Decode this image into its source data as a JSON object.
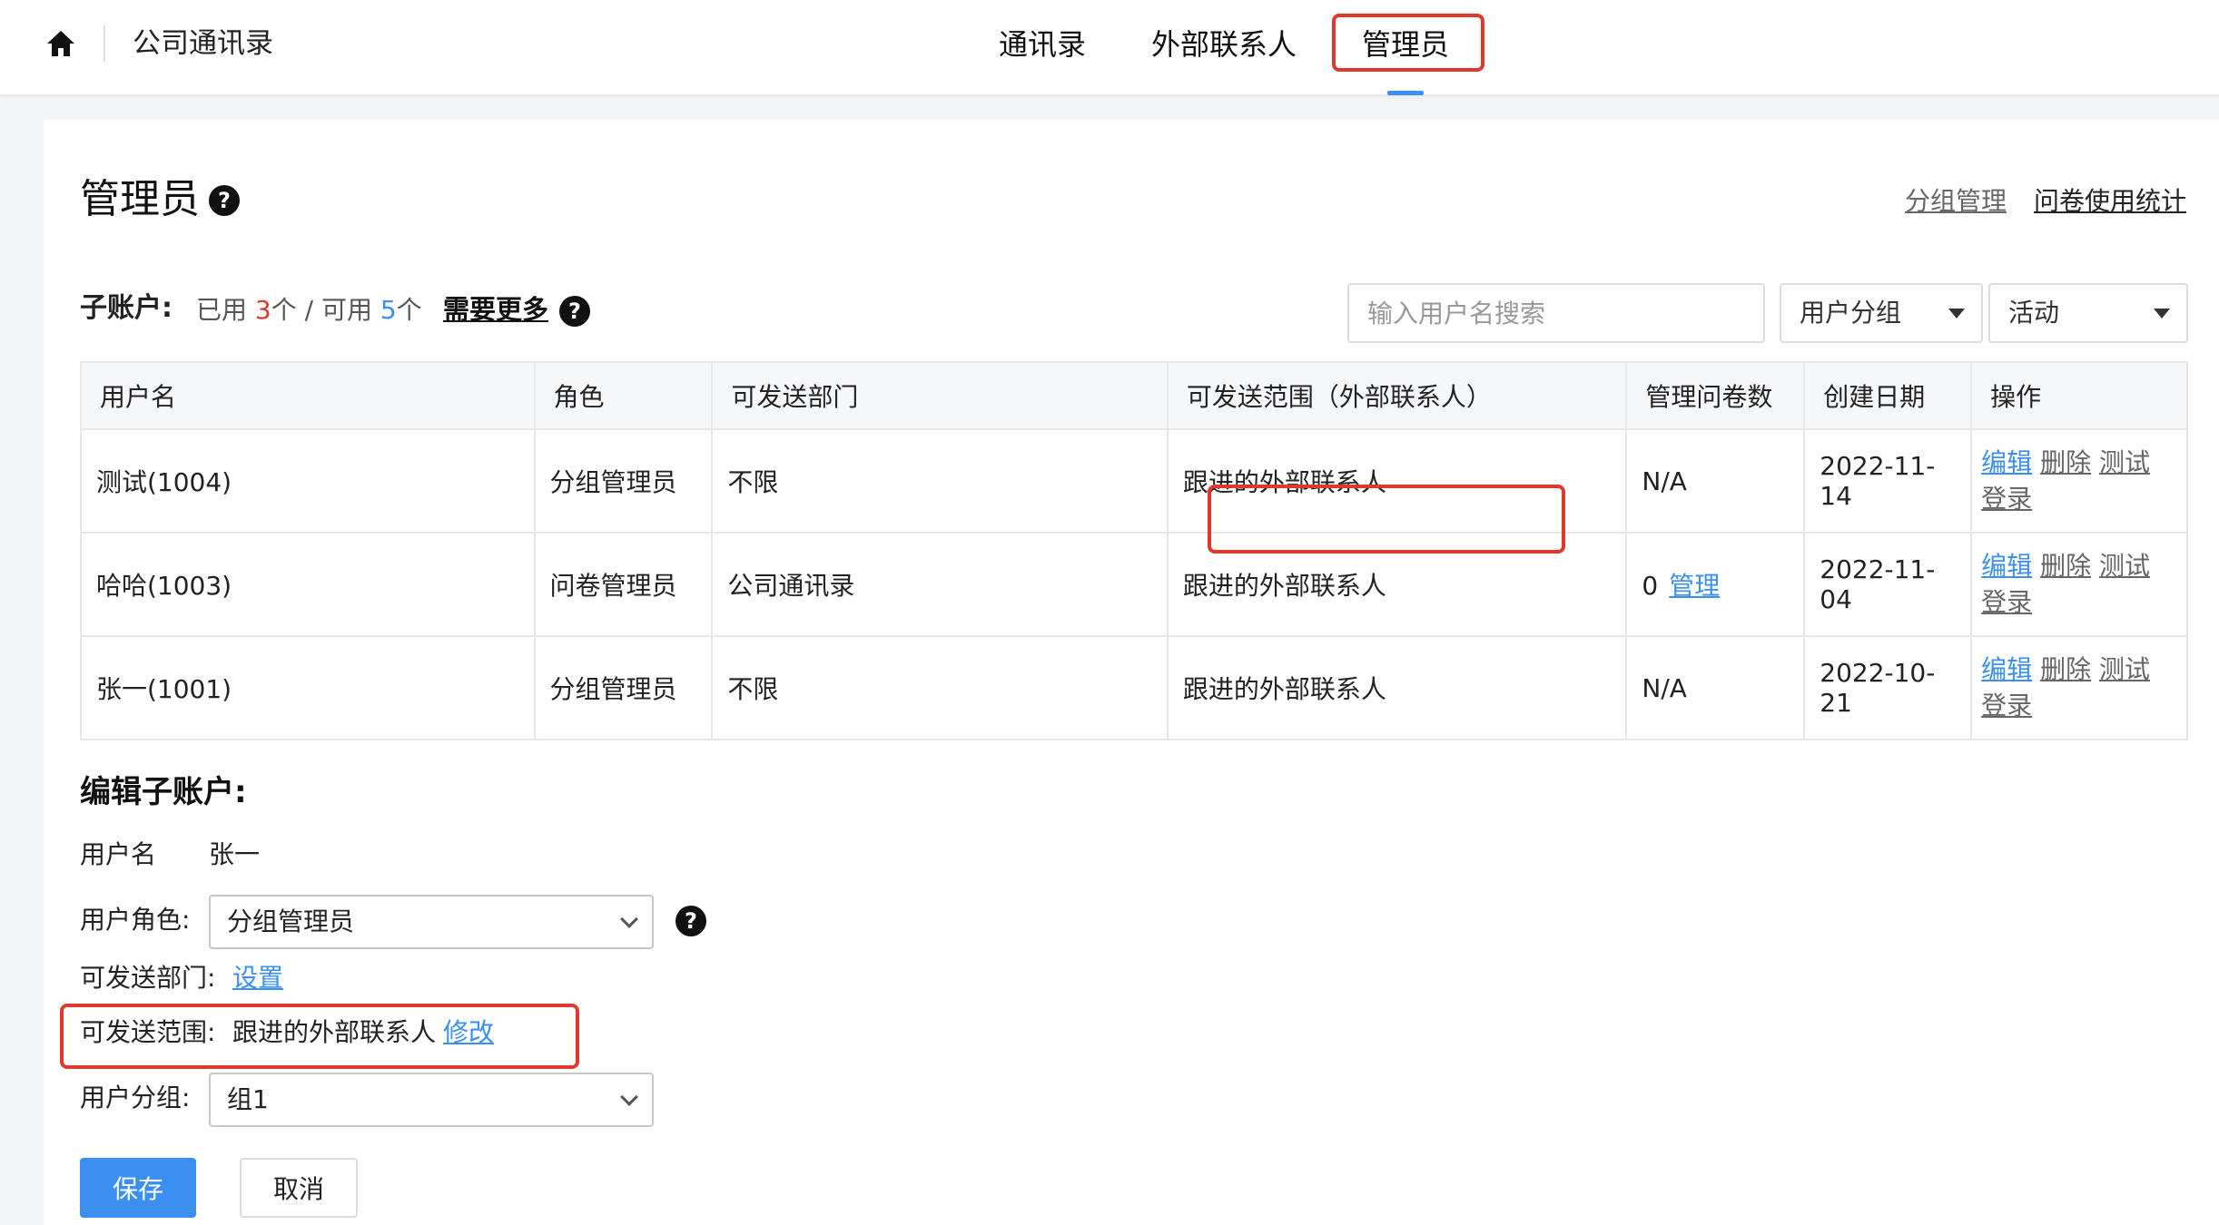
{
  "header": {
    "home_icon": "home-icon",
    "app_title": "公司通讯录",
    "tabs": [
      {
        "label": "通讯录"
      },
      {
        "label": "外部联系人"
      },
      {
        "label": "管理员",
        "active": true
      }
    ]
  },
  "colors": {
    "accent": "#3b8ff0",
    "highlight": "#e0392b",
    "count_used": "#e0392b",
    "count_available": "#3b8ff0"
  },
  "page": {
    "title": "管理员",
    "help_icon": "question-circle-icon",
    "links": {
      "group_manage": "分组管理",
      "survey_stats": "问卷使用统计"
    }
  },
  "subaccounts": {
    "label": "子账户:",
    "used_prefix": "已用 ",
    "used_count": "3",
    "used_suffix": "个 / 可用 ",
    "available_count": "5",
    "available_suffix": "个",
    "need_more": "需要更多"
  },
  "filters": {
    "search_placeholder": "输入用户名搜索",
    "group_select": "用户分组",
    "status_select": "活动"
  },
  "table": {
    "headers": [
      "用户名",
      "角色",
      "可发送部门",
      "可发送范围（外部联系人）",
      "管理问卷数",
      "创建日期",
      "操作"
    ],
    "rows": [
      {
        "username": "测试(1004)",
        "role": "分组管理员",
        "dept": "不限",
        "scope": "跟进的外部联系人",
        "surveys": "N/A",
        "manage": "",
        "date": "2022-11-14"
      },
      {
        "username": "哈哈(1003)",
        "role": "问卷管理员",
        "dept": "公司通讯录",
        "scope": "跟进的外部联系人",
        "surveys": "0",
        "manage": "管理",
        "date": "2022-11-04"
      },
      {
        "username": "张一(1001)",
        "role": "分组管理员",
        "dept": "不限",
        "scope": "跟进的外部联系人",
        "surveys": "N/A",
        "manage": "",
        "date": "2022-10-21"
      }
    ],
    "ops": {
      "edit": "编辑",
      "delete": "删除",
      "test_login_1": "测试",
      "test_login_2": "登录"
    }
  },
  "edit_form": {
    "title": "编辑子账户:",
    "username_label": "用户名",
    "username_value": "张一",
    "role_label": "用户角色:",
    "role_value": "分组管理员",
    "dept_label": "可发送部门:",
    "dept_link": "设置",
    "scope_label": "可发送范围:",
    "scope_value": "跟进的外部联系人",
    "scope_link": "修改",
    "group_label": "用户分组:",
    "group_value": "组1",
    "save": "保存",
    "cancel": "取消"
  }
}
